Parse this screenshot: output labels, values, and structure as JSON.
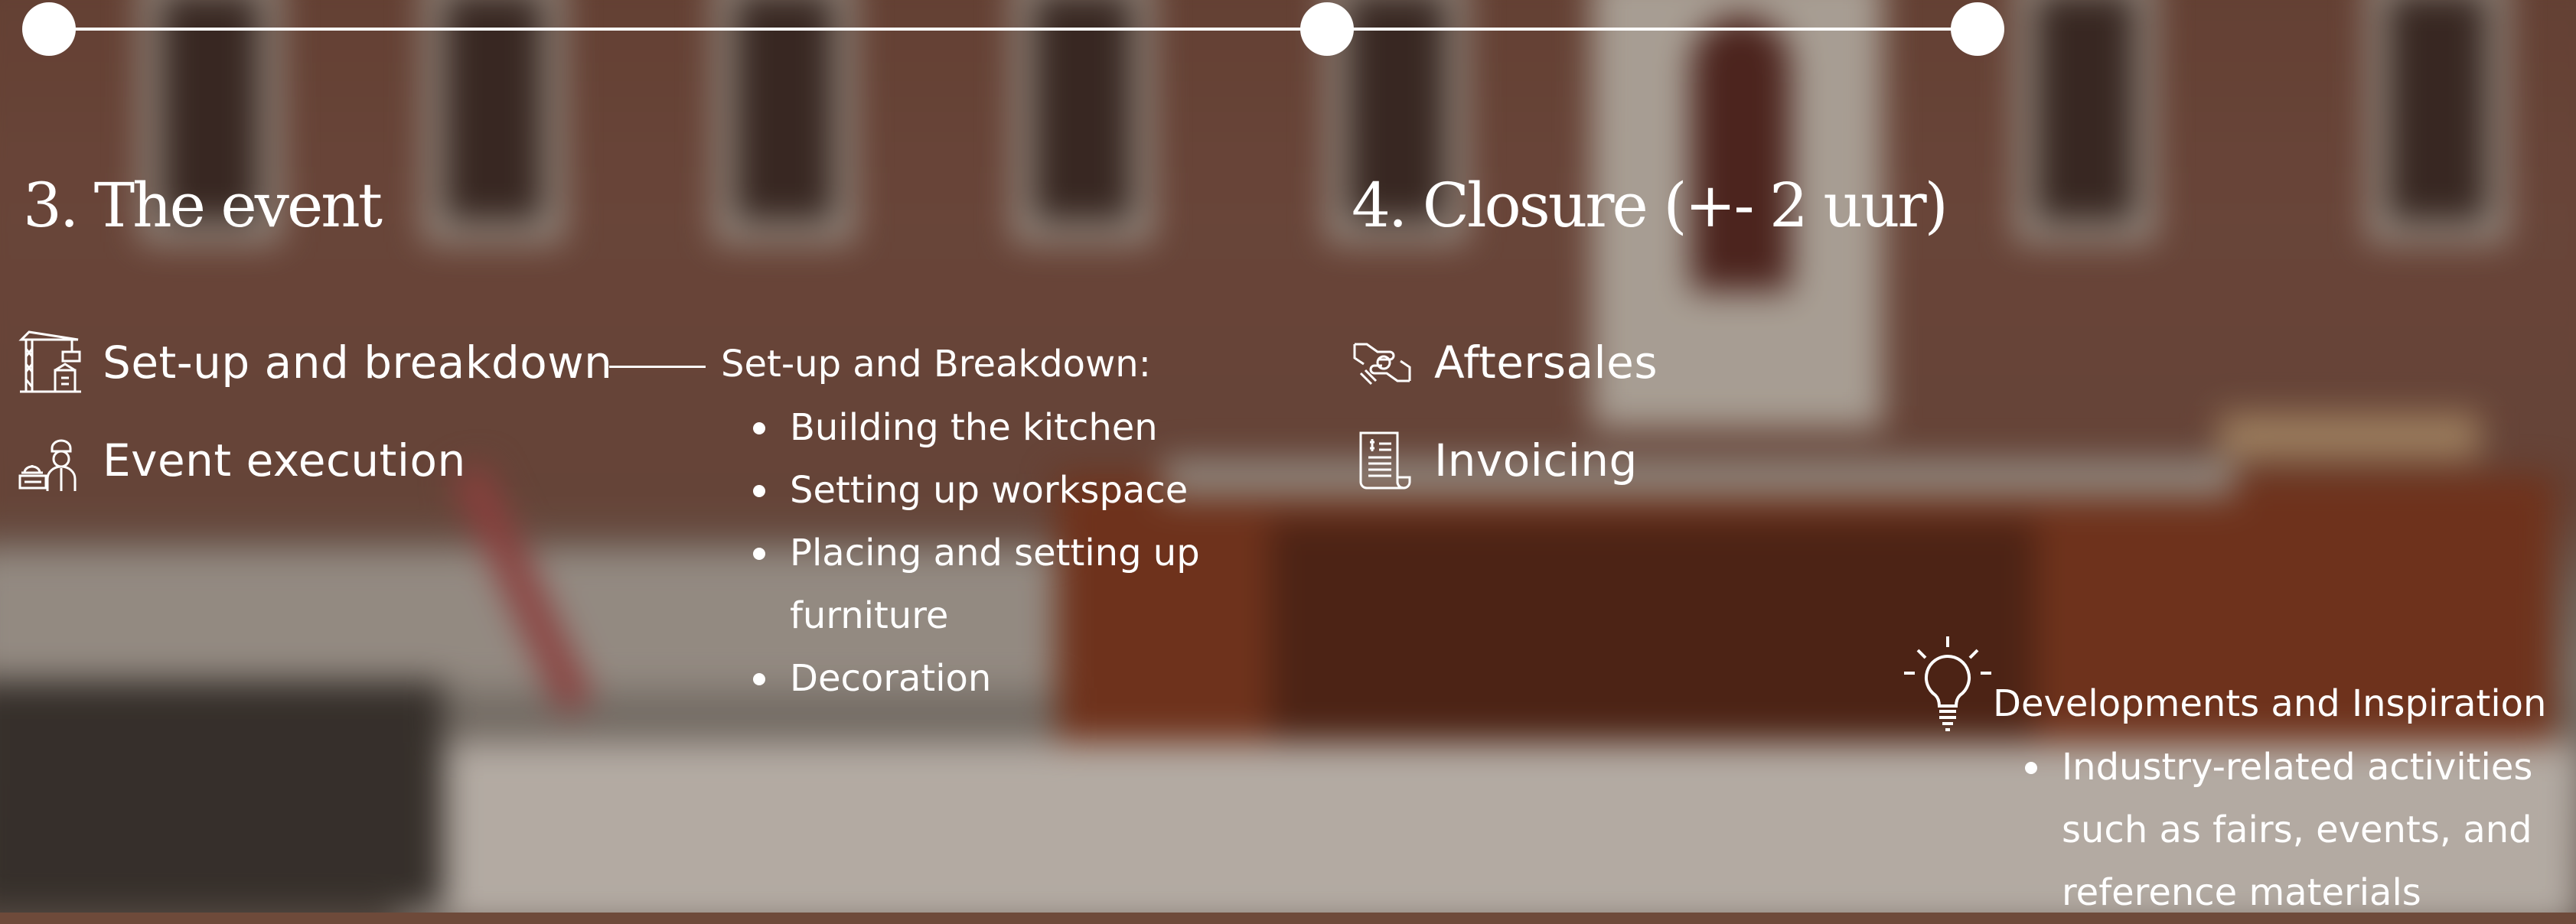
{
  "timeline": {
    "dots": 3
  },
  "sections": [
    {
      "title": "3. The event",
      "items": [
        {
          "label": "Set-up and breakdown",
          "icon": "crane-icon"
        },
        {
          "label": "Event execution",
          "icon": "chef-icon"
        }
      ],
      "detail": {
        "heading": "Set-up and Breakdown:",
        "bullets": [
          [
            "Building the kitchen"
          ],
          [
            "Setting up workspace"
          ],
          [
            "Placing and setting up",
            "furniture"
          ],
          [
            "Decoration"
          ]
        ]
      }
    },
    {
      "title": "4. Closure (+- 2 uur)",
      "items": [
        {
          "label": "Aftersales",
          "icon": "handshake-icon"
        },
        {
          "label": "Invoicing",
          "icon": "invoice-icon"
        }
      ]
    }
  ],
  "inspiration": {
    "icon": "lightbulb-icon",
    "heading": "Developments and Inspiration",
    "bullets": [
      [
        "Industry-related activities",
        "such as fairs, events, and",
        "reference materials"
      ]
    ]
  },
  "colors": {
    "text": "#ffffff",
    "background": "#6e4a3a"
  }
}
